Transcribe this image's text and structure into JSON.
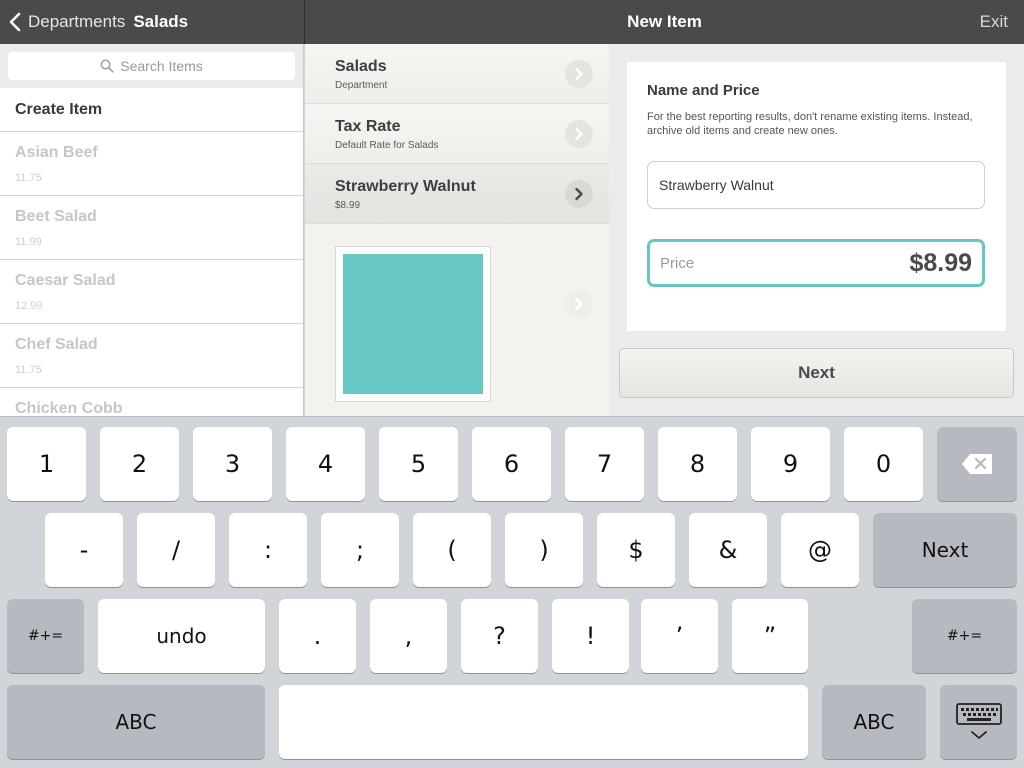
{
  "header": {
    "back_label": "Departments",
    "current_department": "Salads",
    "title": "New Item",
    "exit_label": "Exit"
  },
  "search": {
    "placeholder": "Search Items"
  },
  "item_list": {
    "create_label": "Create Item",
    "items": [
      {
        "name": "Asian Beef",
        "price": "11.75"
      },
      {
        "name": "Beet Salad",
        "price": "11.99"
      },
      {
        "name": "Caesar Salad",
        "price": "12.99"
      },
      {
        "name": "Chef Salad",
        "price": "11.75"
      },
      {
        "name": "Chicken Cobb",
        "price": ""
      }
    ]
  },
  "detail_rows": [
    {
      "title": "Salads",
      "subtitle": "Department"
    },
    {
      "title": "Tax Rate",
      "subtitle": "Default Rate for Salads"
    },
    {
      "title": "Strawberry Walnut",
      "subtitle": "$8.99"
    }
  ],
  "item_image": {
    "color": "#66c7c5"
  },
  "form": {
    "section_title": "Name and Price",
    "hint": "For the best reporting results, don't rename existing items. Instead, archive old items and create new ones.",
    "name_value": "Strawberry Walnut",
    "price_label": "Price",
    "price_value": "$8.99",
    "next_label": "Next"
  },
  "keyboard": {
    "row1": [
      "1",
      "2",
      "3",
      "4",
      "5",
      "6",
      "7",
      "8",
      "9",
      "0"
    ],
    "row2": [
      "-",
      "/",
      ":",
      ";",
      "(",
      ")",
      "$",
      "&",
      "@"
    ],
    "row2_action": "Next",
    "row3_mode": "#+=",
    "row3_undo": "undo",
    "row3": [
      ".",
      ",",
      "?",
      "!",
      "’",
      "”"
    ],
    "row3_mode_right": "#+=",
    "abc_left": "ABC",
    "abc_right": "ABC"
  },
  "colors": {
    "accent": "#66c7c5",
    "header_bg": "#4a4a4a"
  }
}
